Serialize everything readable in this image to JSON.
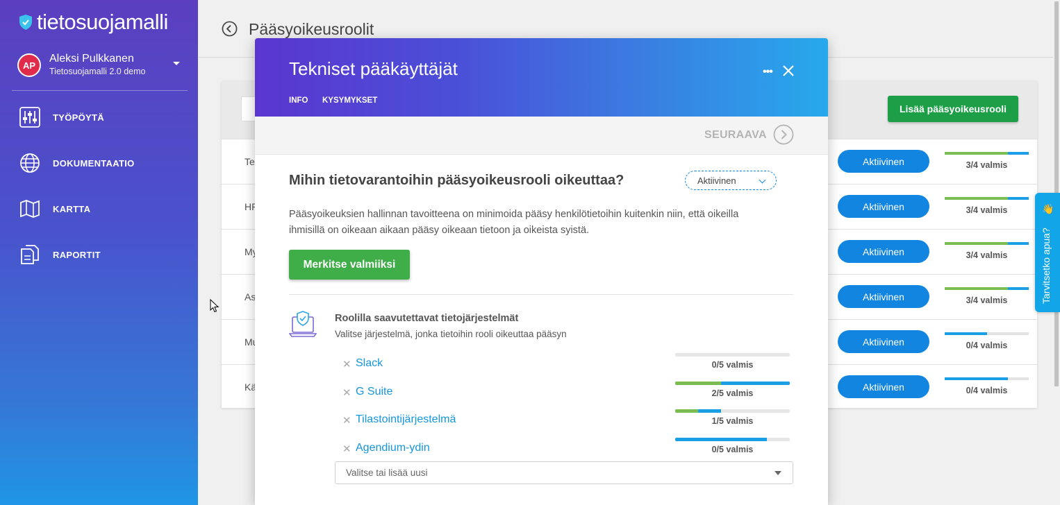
{
  "app": {
    "logo": "tietosuojamalli",
    "brand_color": "#5b3fc0"
  },
  "user": {
    "initials": "AP",
    "name": "Aleksi Pulkkanen",
    "org": "Tietosuojamalli 2.0 demo"
  },
  "sidebar": {
    "items": [
      {
        "label": "TYÖPÖYTÄ",
        "icon": "sliders-icon"
      },
      {
        "label": "DOKUMENTAATIO",
        "icon": "globe-icon"
      },
      {
        "label": "KARTTA",
        "icon": "map-icon"
      },
      {
        "label": "RAPORTIT",
        "icon": "documents-icon"
      }
    ]
  },
  "page": {
    "title": "Pääsyoikeusroolit",
    "add_button": "Lisää pääsyoikeusrooli"
  },
  "rows": [
    {
      "name": "Te",
      "status": "Aktiivinen",
      "progress_label": "3/4 valmis",
      "done_fraction": 0.75,
      "progress_fraction": 1.0
    },
    {
      "name": "HR",
      "status": "Aktiivinen",
      "progress_label": "3/4 valmis",
      "done_fraction": 0.75,
      "progress_fraction": 1.0
    },
    {
      "name": "My",
      "status": "Aktiivinen",
      "progress_label": "3/4 valmis",
      "done_fraction": 0.75,
      "progress_fraction": 1.0
    },
    {
      "name": "As",
      "status": "Aktiivinen",
      "progress_label": "3/4 valmis",
      "done_fraction": 0.75,
      "progress_fraction": 1.0
    },
    {
      "name": "Mu",
      "status": "Aktiivinen",
      "progress_label": "0/4 valmis",
      "done_fraction": 0,
      "progress_fraction": 0.5
    },
    {
      "name": "Kä",
      "status": "Aktiivinen",
      "progress_label": "0/4 valmis",
      "done_fraction": 0,
      "progress_fraction": 0.75
    }
  ],
  "modal": {
    "title": "Tekniset pääkäyttäjät",
    "more": "•••",
    "tabs": [
      "INFO",
      "KYSYMYKSET"
    ],
    "next_label": "SEURAAVA",
    "question": "Mihin tietovarantoihin pääsyoikeusrooli oikeuttaa?",
    "status": "Aktiivinen",
    "description": "Pääsyoikeuksien hallinnan tavoitteena on minimoida pääsy henkilötietoihin kuitenkin niin, että oikeilla ihmisillä on oikeaan aikaan pääsy oikeaan tietoon ja oikeista syistä.",
    "done_button": "Merkitse valmiiksi",
    "systems_title": "Roolilla saavutettavat tietojärjestelmät",
    "systems_subtitle": "Valitse järjestelmä, jonka tietoihin rooli oikeuttaa pääsyn",
    "remove_symbol": "✕",
    "systems": [
      {
        "name": "Slack",
        "progress_label": "0/5 valmis",
        "done_fraction": 0,
        "progress_fraction": 0
      },
      {
        "name": "G Suite",
        "progress_label": "2/5 valmis",
        "done_fraction": 0.4,
        "progress_fraction": 1.0
      },
      {
        "name": "Tilastointijärjestelmä",
        "progress_label": "1/5 valmis",
        "done_fraction": 0.2,
        "progress_fraction": 0.4
      },
      {
        "name": "Agendium-ydin",
        "progress_label": "0/5 valmis",
        "done_fraction": 0,
        "progress_fraction": 0.8
      }
    ],
    "combo_placeholder": "Valitse tai lisää uusi"
  },
  "help": {
    "label": "Tarvitsetko apua?",
    "emoji": "👋"
  }
}
